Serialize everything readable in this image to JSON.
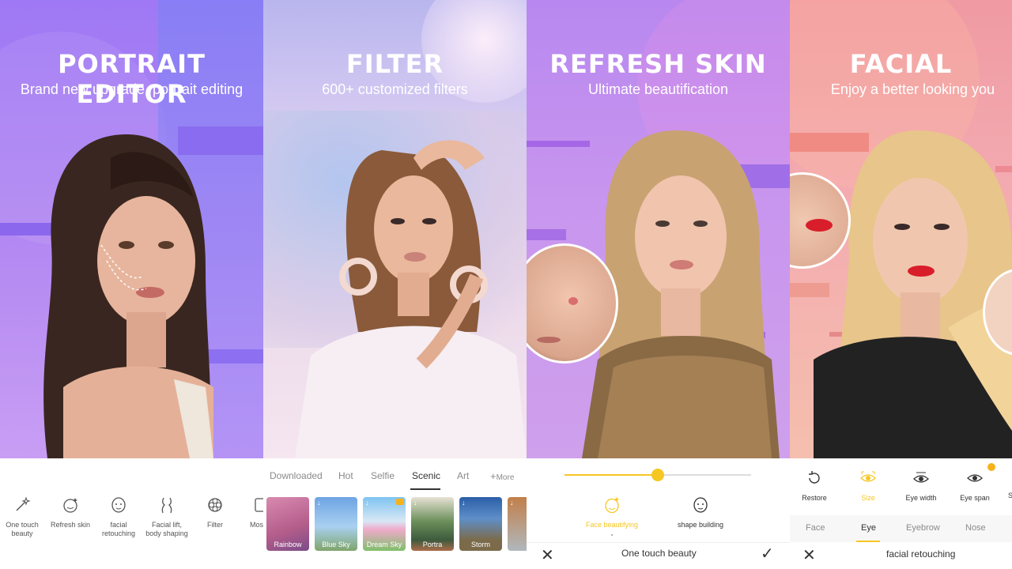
{
  "panels": {
    "portrait": {
      "title": "PORTRAIT EDITOR",
      "subtitle": "Brand new upgrade, portrait editing",
      "tools": [
        {
          "icon": "magic-wand-icon",
          "label": "One touch\nbeauty"
        },
        {
          "icon": "face-sparkle-icon",
          "label": "Refresh skin"
        },
        {
          "icon": "face-icon",
          "label": "facial\nretouching"
        },
        {
          "icon": "body-shape-icon",
          "label": "Facial lift,\nbody shaping"
        },
        {
          "icon": "aperture-icon",
          "label": "Filter"
        },
        {
          "icon": "mosaic-icon",
          "label": "Mos"
        }
      ]
    },
    "filter": {
      "title": "FILTER",
      "subtitle": "600+ customized filters",
      "tabs": [
        "Downloaded",
        "Hot",
        "Selfie",
        "Scenic",
        "Art",
        "More"
      ],
      "active_tab": "Scenic",
      "thumbs": [
        "Rainbow",
        "Blue Sky",
        "Dream Sky",
        "Portra",
        "Storm",
        ""
      ]
    },
    "skin": {
      "title": "REFRESH SKIN",
      "subtitle": "Ultimate beautification",
      "slider_value": 0.5,
      "options": [
        {
          "icon": "face-beautify-icon",
          "label": "Face beautifying",
          "active": true
        },
        {
          "icon": "face-shape-icon",
          "label": "shape building",
          "active": false
        }
      ],
      "footer": "One touch beauty"
    },
    "facial": {
      "title": "FACIAL",
      "subtitle": "Enjoy a better looking you",
      "tools": [
        {
          "icon": "restore-icon",
          "label": "Restore"
        },
        {
          "icon": "eye-size-icon",
          "label": "Size"
        },
        {
          "icon": "eye-width-icon",
          "label": "Eye width"
        },
        {
          "icon": "eye-span-icon",
          "label": "Eye span"
        },
        {
          "icon": "s-icon",
          "label": "S"
        }
      ],
      "tabs": [
        "Face",
        "Eye",
        "Eyebrow",
        "Nose"
      ],
      "active_tab": "Eye",
      "footer": "facial retouching"
    }
  },
  "colors": {
    "accent_yellow": "#f6c623",
    "purple": "#a46ff0",
    "pink": "#f19aa6"
  }
}
